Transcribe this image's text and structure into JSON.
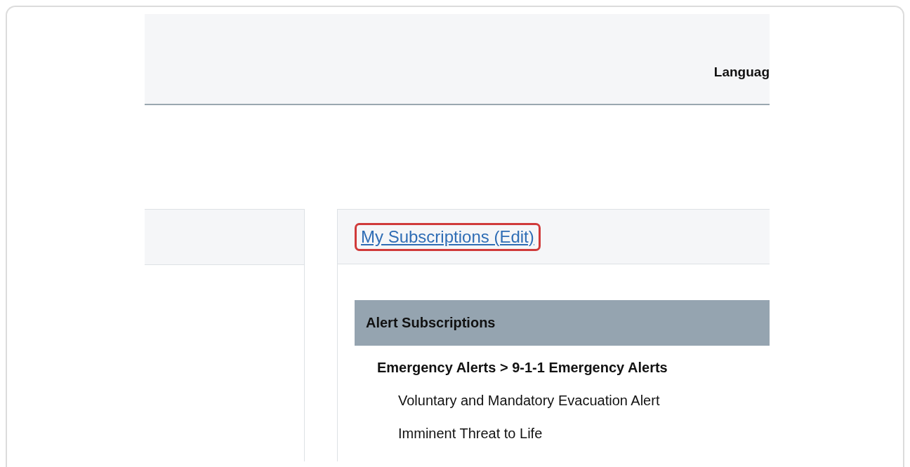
{
  "header": {
    "language_label": "Languag"
  },
  "subscriptions_panel": {
    "title_link": {
      "label": "My Subscriptions (Edit)",
      "highlighted": true
    },
    "section": {
      "title": "Alert Subscriptions",
      "groups": [
        {
          "label": "Emergency Alerts > 9-1-1 Emergency Alerts",
          "children": [
            {
              "label": "Voluntary and Mandatory Evacuation Alert"
            },
            {
              "label": "Imminent Threat to Life"
            }
          ]
        }
      ]
    }
  }
}
